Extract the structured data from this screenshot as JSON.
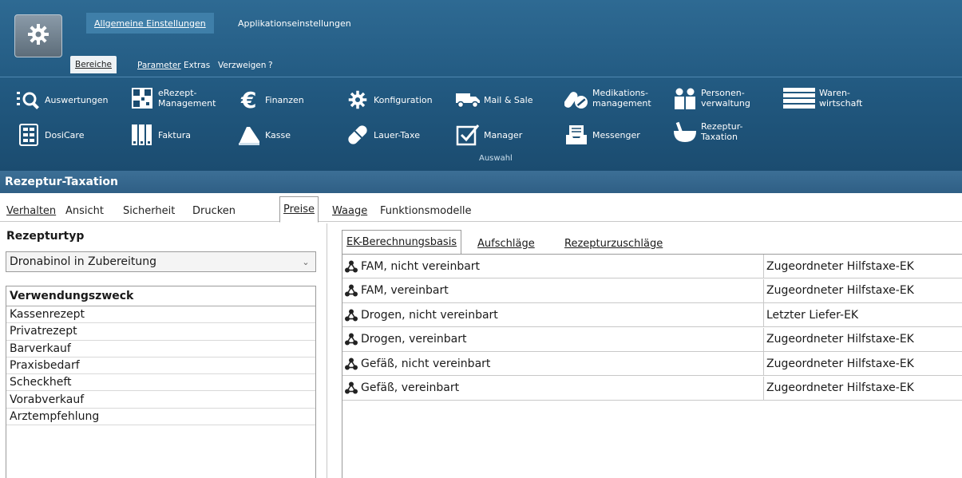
{
  "ribbon": {
    "top_tabs": [
      "Allgemeine Einstellungen",
      "Applikationseinstellungen"
    ],
    "menu": [
      "Bereiche",
      "Parameter",
      "Extras",
      "Verzweigen",
      "?"
    ],
    "buttons": [
      {
        "label": "Auswertungen",
        "icon": "report-search-icon"
      },
      {
        "label": "eRezept-\nManagement",
        "icon": "qr-code-icon"
      },
      {
        "label": "Finanzen",
        "icon": "euro-icon"
      },
      {
        "label": "Konfiguration",
        "icon": "gear-icon"
      },
      {
        "label": "Mail & Sale",
        "icon": "delivery-truck-icon"
      },
      {
        "label": "Medikations-\nmanagement",
        "icon": "pills-icon"
      },
      {
        "label": "Personen-\nverwaltung",
        "icon": "people-icon"
      },
      {
        "label": "Waren-\nwirtschaft",
        "icon": "shelves-icon"
      },
      {
        "label": "DosiCare",
        "icon": "dosage-box-icon"
      },
      {
        "label": "Faktura",
        "icon": "invoice-icon"
      },
      {
        "label": "Kasse",
        "icon": "cash-register-icon"
      },
      {
        "label": "Lauer-Taxe",
        "icon": "capsule-icon"
      },
      {
        "label": "Manager",
        "icon": "checkbox-icon"
      },
      {
        "label": "Messenger",
        "icon": "inbox-icon"
      },
      {
        "label": "Rezeptur-\nTaxation",
        "icon": "mortar-icon"
      }
    ],
    "group_label": "Auswahl"
  },
  "panel_title": "Rezeptur-Taxation",
  "tabs": [
    "Verhalten",
    "Ansicht",
    "Sicherheit",
    "Drucken",
    "Preise",
    "Waage",
    "Funktionsmodelle"
  ],
  "left": {
    "label": "Rezepturtyp",
    "combo_value": "Dronabinol in Zubereitung",
    "list_header": "Verwendungszweck",
    "items": [
      "Kassenrezept",
      "Privatrezept",
      "Barverkauf",
      "Praxisbedarf",
      "Scheckheft",
      "Vorabverkauf",
      "Arztempfehlung"
    ]
  },
  "right": {
    "subtabs": [
      "EK-Berechnungsbasis",
      "Aufschläge",
      "Rezepturzuschläge"
    ],
    "rows": [
      {
        "name": "FAM, nicht vereinbart",
        "value": "Zugeordneter Hilfstaxe-EK"
      },
      {
        "name": "FAM, vereinbart",
        "value": "Zugeordneter Hilfstaxe-EK"
      },
      {
        "name": "Drogen, nicht vereinbart",
        "value": "Letzter Liefer-EK"
      },
      {
        "name": "Drogen, vereinbart",
        "value": "Zugeordneter Hilfstaxe-EK"
      },
      {
        "name": "Gefäß, nicht vereinbart",
        "value": "Zugeordneter Hilfstaxe-EK"
      },
      {
        "name": "Gefäß, vereinbart",
        "value": "Zugeordneter Hilfstaxe-EK"
      }
    ]
  }
}
